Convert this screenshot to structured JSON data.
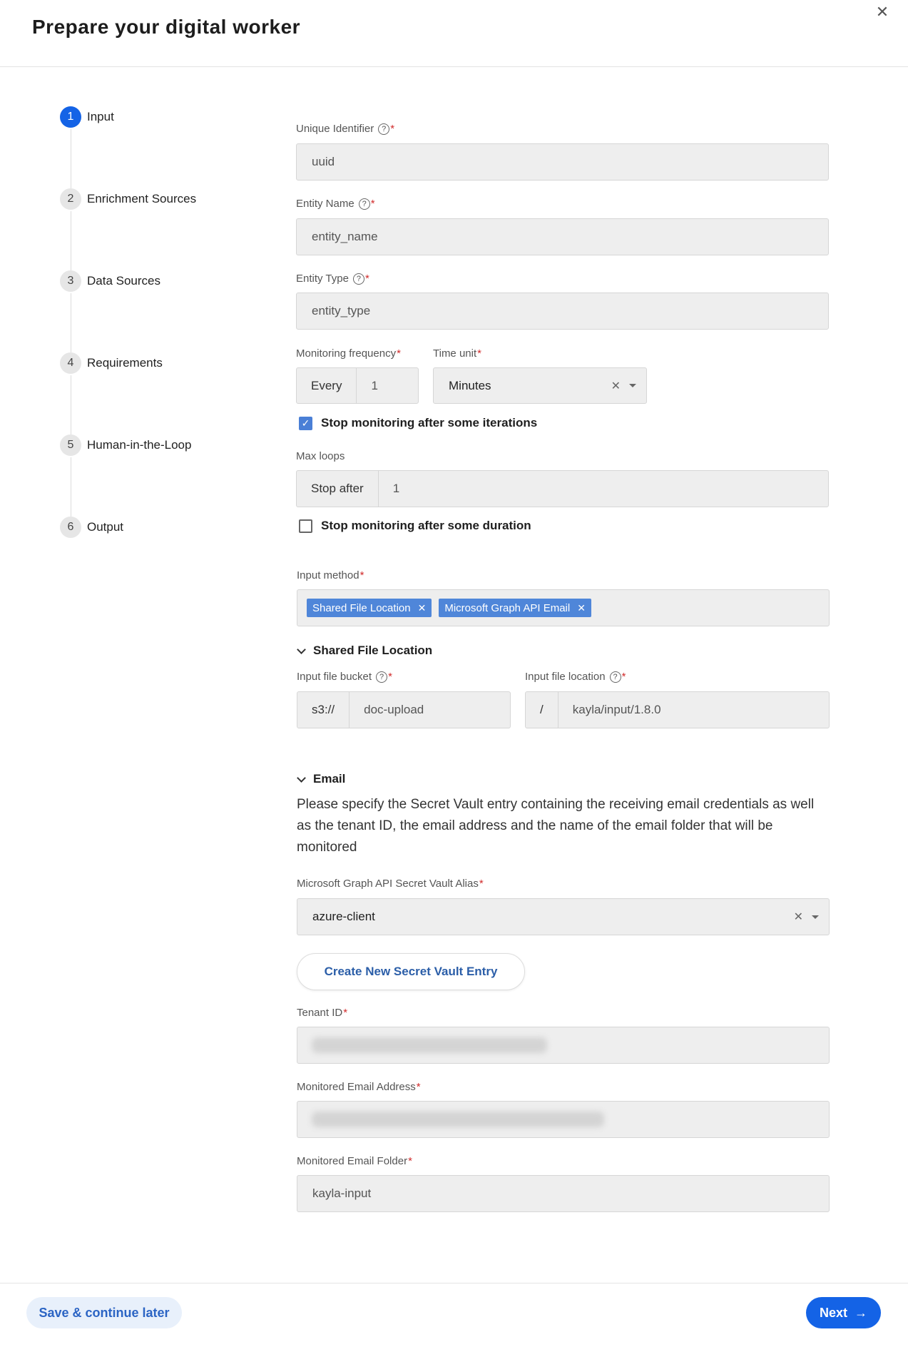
{
  "header": {
    "title": "Prepare your digital worker"
  },
  "steps": [
    {
      "num": "1",
      "label": "Input"
    },
    {
      "num": "2",
      "label": "Enrichment Sources"
    },
    {
      "num": "3",
      "label": "Data Sources"
    },
    {
      "num": "4",
      "label": "Requirements"
    },
    {
      "num": "5",
      "label": "Human-in-the-Loop"
    },
    {
      "num": "6",
      "label": "Output"
    }
  ],
  "form": {
    "unique_identifier": {
      "label": "Unique Identifier",
      "value": "uuid"
    },
    "entity_name": {
      "label": "Entity Name",
      "value": "entity_name"
    },
    "entity_type": {
      "label": "Entity Type",
      "value": "entity_type"
    },
    "monitoring_frequency": {
      "label": "Monitoring frequency",
      "prefix": "Every",
      "value": "1"
    },
    "time_unit": {
      "label": "Time unit",
      "value": "Minutes"
    },
    "stop_iterations": {
      "label": "Stop monitoring after some iterations",
      "checked": true
    },
    "max_loops": {
      "label": "Max loops",
      "prefix": "Stop after",
      "value": "1"
    },
    "stop_duration": {
      "label": "Stop monitoring after some duration",
      "checked": false
    },
    "input_method": {
      "label": "Input method",
      "chips": [
        "Shared File Location",
        "Microsoft Graph API Email"
      ]
    },
    "shared_section": {
      "title": "Shared File Location"
    },
    "input_file_bucket": {
      "label": "Input file bucket",
      "prefix": "s3://",
      "value": "doc-upload"
    },
    "input_file_location": {
      "label": "Input file location",
      "prefix": "/",
      "value": "kayla/input/1.8.0"
    },
    "email_section": {
      "title": "Email",
      "description": "Please specify the Secret Vault entry containing the receiving email credentials as well as the tenant ID, the email address and the name of the email folder that will be monitored"
    },
    "secret_vault_alias": {
      "label": "Microsoft Graph API Secret Vault Alias",
      "value": "azure-client"
    },
    "create_entry": {
      "label": "Create New Secret Vault Entry"
    },
    "tenant_id": {
      "label": "Tenant ID"
    },
    "monitored_email": {
      "label": "Monitored Email Address"
    },
    "monitored_folder": {
      "label": "Monitored Email Folder",
      "value": "kayla-input"
    }
  },
  "footer": {
    "save_label": "Save & continue later",
    "next_label": "Next"
  },
  "icons": {
    "close": "close-icon",
    "help": "help-circle-icon",
    "clear": "clear-icon",
    "dropdown": "chevron-down-icon",
    "arrow": "arrow-right-icon"
  },
  "colors": {
    "primary": "#1463e6",
    "chip": "#4f86d9",
    "required": "#d12b2b"
  }
}
